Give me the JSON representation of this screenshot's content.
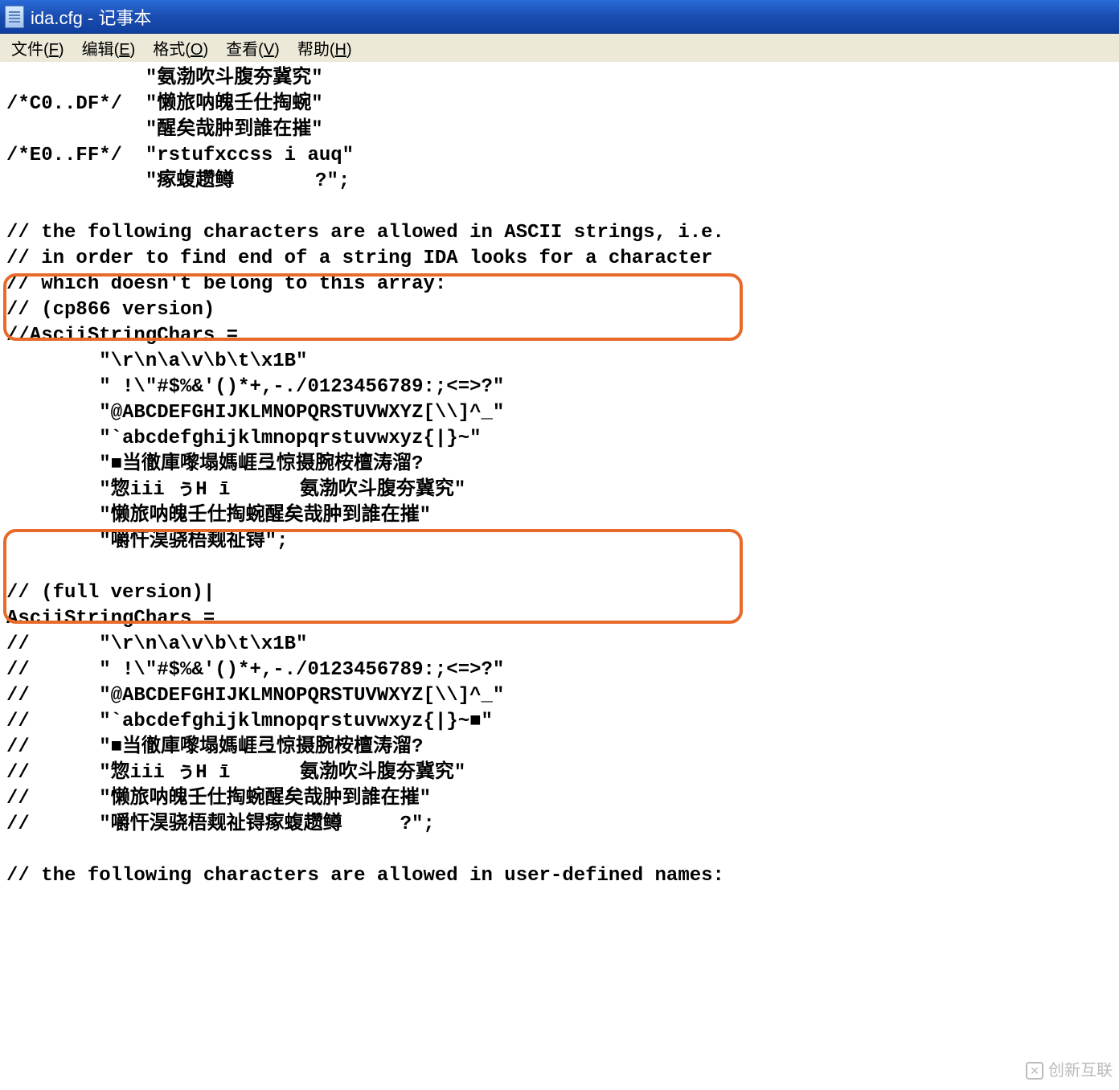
{
  "window": {
    "title": "ida.cfg - 记事本"
  },
  "menu": {
    "file": {
      "label": "文件",
      "accel": "F"
    },
    "edit": {
      "label": "编辑",
      "accel": "E"
    },
    "format": {
      "label": "格式",
      "accel": "O"
    },
    "view": {
      "label": "查看",
      "accel": "V"
    },
    "help": {
      "label": "帮助",
      "accel": "H"
    }
  },
  "content": {
    "lines": [
      "            \"氨渤吹斗腹夯冀究\"",
      "/*C0..DF*/  \"懒旅呐魄壬仕掏蜿\"",
      "            \"醒矣哉肿到誰在摧\"",
      "/*E0..FF*/  \"rstufxccss i auq\"",
      "            \"瘃蝮趱鳟       ?\";",
      "",
      "// the following characters are allowed in ASCII strings, i.e.",
      "// in order to find end of a string IDA looks for a character",
      "// which doesn't belong to this array:",
      "// (cp866 version)",
      "//AsciiStringChars =",
      "        \"\\r\\n\\a\\v\\b\\t\\x1B\"",
      "        \" !\\\"#$%&'()*+,-./0123456789:;<=>?\"",
      "        \"@ABCDEFGHIJKLMNOPQRSTUVWXYZ[\\\\]^_\"",
      "        \"`abcdefghijklmnopqrstuvwxyz{|}~\"",
      "        \"■当徹庫嚟塌媽崕弖惊摄腕桉檀涛溜?",
      "        \"惣iii ぅH ī      氨渤吹斗腹夯冀究\"",
      "        \"懒旅呐魄壬仕掏蜿醒矣哉肿到誰在摧\"",
      "        \"嚼忓淏骁梧觌祉锝\";",
      "",
      "// (full version)|",
      "AsciiStringChars =",
      "//      \"\\r\\n\\a\\v\\b\\t\\x1B\"",
      "//      \" !\\\"#$%&'()*+,-./0123456789:;<=>?\"",
      "//      \"@ABCDEFGHIJKLMNOPQRSTUVWXYZ[\\\\]^_\"",
      "//      \"`abcdefghijklmnopqrstuvwxyz{|}~■\"",
      "//      \"■当徹庫嚟塌媽崕弖惊摄腕桉檀涛溜?",
      "//      \"惣iii ぅH ī      氨渤吹斗腹夯冀究\"",
      "//      \"懒旅呐魄壬仕掏蜿醒矣哉肿到誰在摧\"",
      "//      \"嚼忓淏骁梧觌祉锝瘃蝮趱鳟     ?\";",
      "",
      "// the following characters are allowed in user-defined names:"
    ]
  },
  "watermark": "创新互联"
}
